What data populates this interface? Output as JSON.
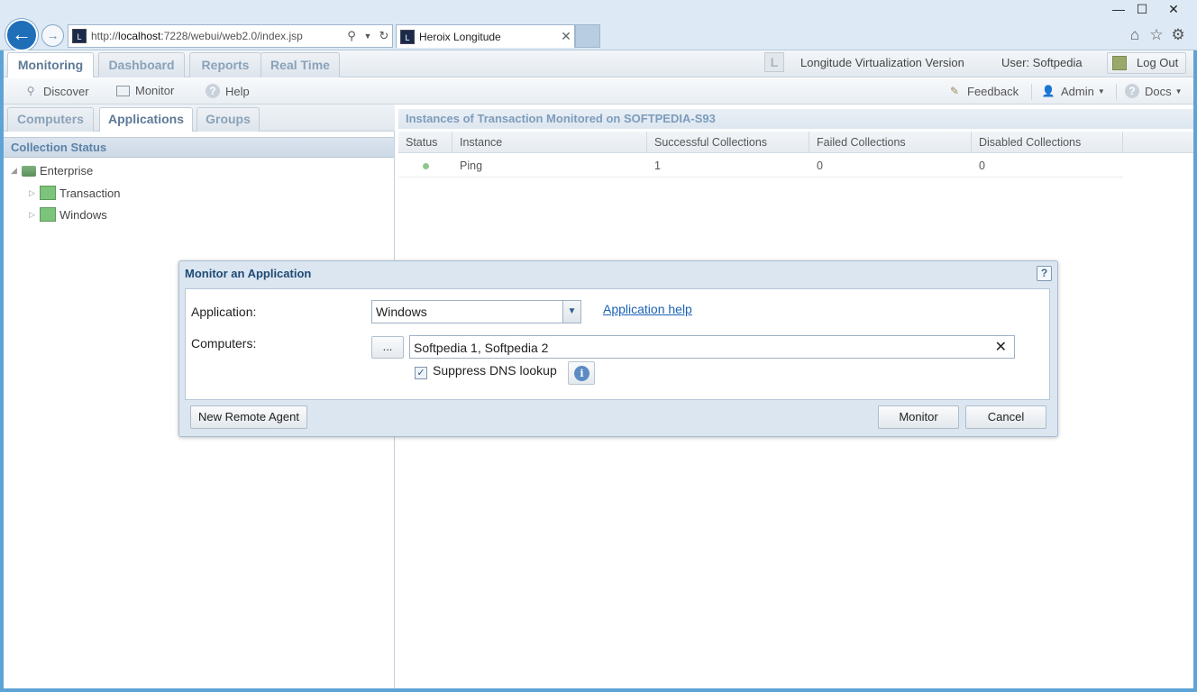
{
  "browser": {
    "url_prefix": "http://",
    "url_host": "localhost",
    "url_rest": ":7228/webui/web2.0/index.jsp",
    "tab_title": "Heroix Longitude",
    "icons": [
      "back-arrow-icon",
      "forward-arrow-icon",
      "search-icon",
      "refresh-icon",
      "home-icon",
      "star-icon",
      "gear-icon"
    ]
  },
  "topnav": {
    "tabs": [
      "Monitoring",
      "Dashboard",
      "Reports",
      "Real Time"
    ],
    "version": "Longitude Virtualization Version",
    "user": "User: Softpedia",
    "logout": "Log Out"
  },
  "toolbar": {
    "discover": "Discover",
    "monitor": "Monitor",
    "help": "Help",
    "feedback": "Feedback",
    "admin": "Admin",
    "docs": "Docs"
  },
  "left": {
    "tabs": [
      "Computers",
      "Applications",
      "Groups"
    ],
    "header": "Collection Status",
    "tree": {
      "root": "Enterprise",
      "children": [
        "Transaction",
        "Windows"
      ]
    }
  },
  "right": {
    "header": "Instances of Transaction Monitored on SOFTPEDIA-S93",
    "columns": [
      "Status",
      "Instance",
      "Successful Collections",
      "Failed Collections",
      "Disabled Collections"
    ],
    "rows": [
      {
        "status": "green",
        "instance": "Ping",
        "successful": "1",
        "failed": "0",
        "disabled": "0"
      }
    ]
  },
  "modal": {
    "title": "Monitor an Application",
    "application_label": "Application:",
    "application_value": "Windows",
    "application_help": "Application help",
    "computers_label": "Computers:",
    "browse_button": "...",
    "computers_value": "Softpedia 1, Softpedia 2",
    "suppress_dns": "Suppress DNS lookup",
    "suppress_dns_checked": true,
    "new_remote_agent": "New Remote Agent",
    "monitor": "Monitor",
    "cancel": "Cancel"
  },
  "colors": {
    "accent": "#1e6fb8",
    "header_text": "#5b82a8",
    "link": "#1a62b4",
    "status_ok": "#8ec78e"
  }
}
